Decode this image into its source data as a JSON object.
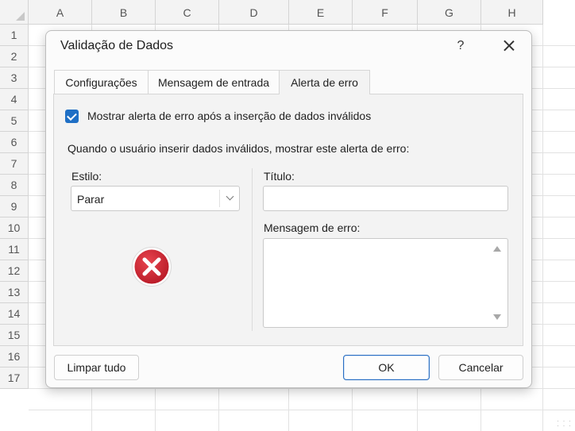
{
  "spreadsheet": {
    "columns": [
      "A",
      "B",
      "C",
      "D",
      "E",
      "F",
      "G",
      "H"
    ],
    "rows": [
      "1",
      "2",
      "3",
      "4",
      "5",
      "6",
      "7",
      "8",
      "9",
      "10",
      "11",
      "12",
      "13",
      "14",
      "15",
      "16",
      "17"
    ]
  },
  "dialog": {
    "title": "Validação de Dados",
    "help_label": "?",
    "tabs": [
      {
        "label": "Configurações",
        "active": false
      },
      {
        "label": "Mensagem de entrada",
        "active": false
      },
      {
        "label": "Alerta de erro",
        "active": true
      }
    ],
    "show_alert": {
      "checked": true,
      "label": "Mostrar alerta de erro após a inserção de dados inválidos"
    },
    "intro_text": "Quando o usuário inserir dados inválidos, mostrar este alerta de erro:",
    "style": {
      "label": "Estilo:",
      "value": "Parar",
      "icon": "stop-error-icon"
    },
    "title_field": {
      "label": "Título:",
      "value": ""
    },
    "message_field": {
      "label": "Mensagem de erro:",
      "value": ""
    },
    "buttons": {
      "clear": "Limpar tudo",
      "ok": "OK",
      "cancel": "Cancelar"
    }
  },
  "colors": {
    "accent": "#1f6fc5",
    "error_icon": "#c8202f",
    "panel_bg": "#f3f3f3"
  }
}
